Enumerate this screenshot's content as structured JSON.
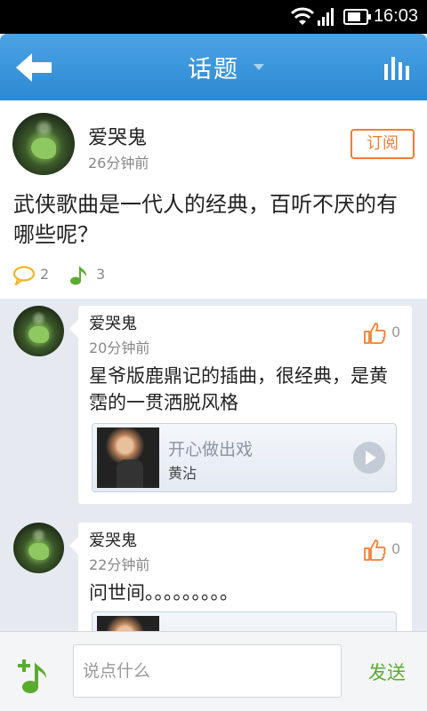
{
  "status_bar": {
    "time": "16:03"
  },
  "header": {
    "title": "话题",
    "back_icon": "back-arrow-icon",
    "stats_icon": "bar-chart-icon"
  },
  "topic": {
    "author": "爱哭鬼",
    "time_ago": "26分钟前",
    "subscribe_label": "订阅",
    "body": "武侠歌曲是一代人的经典，百听不厌的有哪些呢？",
    "comment_count": "2",
    "music_count": "3"
  },
  "comments": [
    {
      "author": "爱哭鬼",
      "time_ago": "20分钟前",
      "likes": "0",
      "text": "星爷版鹿鼎记的插曲，很经典，是黄霑的一贯洒脱风格",
      "song": {
        "title": "开心做出戏",
        "artist": "黄沾"
      }
    },
    {
      "author": "爱哭鬼",
      "time_ago": "22分钟前",
      "likes": "0",
      "text": "问世间。。。。。。。。。"
    }
  ],
  "input_bar": {
    "placeholder": "说点什么",
    "send_label": "发送"
  },
  "colors": {
    "header_blue": "#3a96dc",
    "accent_orange": "#f27d33",
    "accent_green": "#5aac2f"
  }
}
